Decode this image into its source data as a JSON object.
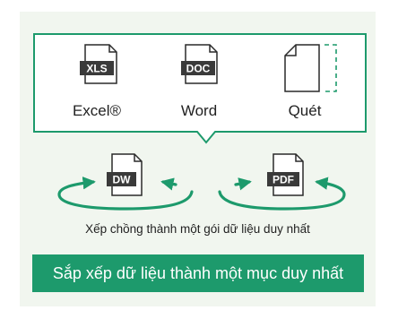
{
  "sources": [
    {
      "badge": "XLS",
      "label": "Excel®",
      "icon": "xls-file-icon"
    },
    {
      "badge": "DOC",
      "label": "Word",
      "icon": "doc-file-icon"
    },
    {
      "badge": "",
      "label": "Quét",
      "icon": "scan-page-icon"
    }
  ],
  "outputs": [
    {
      "badge": "DW",
      "icon": "dw-file-icon"
    },
    {
      "badge": "PDF",
      "icon": "pdf-file-icon"
    }
  ],
  "caption": "Xếp chồng thành một gói dữ liệu duy nhất",
  "banner": "Sắp xếp dữ liệu thành một mục duy nhất",
  "colors": {
    "accent": "#1d9a6c",
    "panel": "#f1f6ef",
    "ink": "#2a2a2a",
    "badge": "#3a3a3a"
  }
}
